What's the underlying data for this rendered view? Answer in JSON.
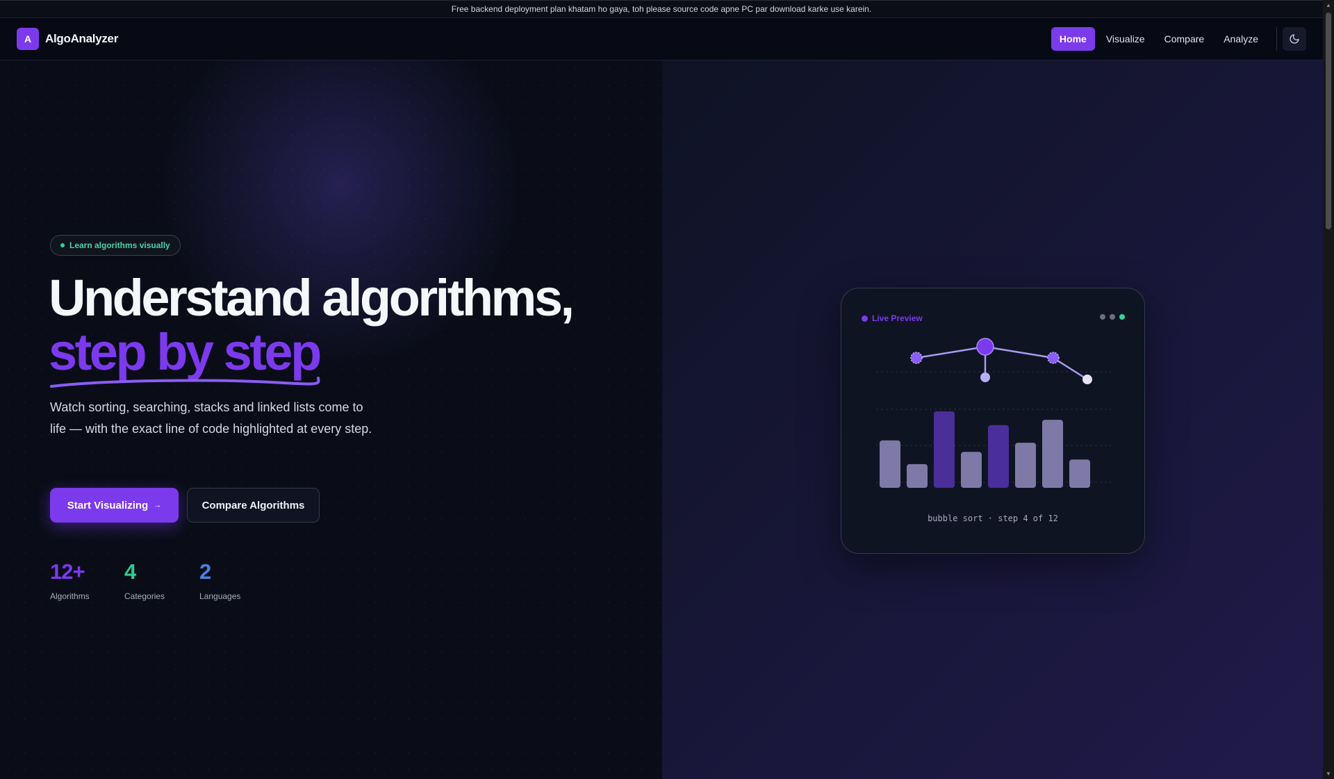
{
  "banner": {
    "text": "Free backend deployment plan khatam ho gaya, toh please source code apne PC par download karke use karein."
  },
  "brand": {
    "logo_letter": "A",
    "name": "AlgoAnalyzer"
  },
  "nav": {
    "links": [
      {
        "label": "Home",
        "active": true
      },
      {
        "label": "Visualize",
        "active": false
      },
      {
        "label": "Compare",
        "active": false
      },
      {
        "label": "Analyze",
        "active": false
      }
    ],
    "theme_toggle_icon": "moon-icon"
  },
  "hero": {
    "badge": "Learn algorithms visually",
    "title_line1": "Understand algorithms,",
    "title_line2": "step by step",
    "description": "Watch sorting, searching, stacks and linked lists come to life — with the exact line of code highlighted at every step.",
    "primary_button": "Start Visualizing",
    "primary_arrow": "→",
    "secondary_button": "Compare Algorithms",
    "stats": [
      {
        "value": "12+",
        "label": "Algorithms",
        "color": "#7c3aed"
      },
      {
        "value": "4",
        "label": "Categories",
        "color": "#34c98f"
      },
      {
        "value": "2",
        "label": "Languages",
        "color": "#4d7fe0"
      }
    ]
  },
  "preview": {
    "title": "Live Preview",
    "caption": "bubble sort · step 4 of 12",
    "bar_values": [
      0.62,
      0.31,
      1.0,
      0.47,
      0.82,
      0.59,
      0.89,
      0.37
    ],
    "bar_highlight": [
      false,
      false,
      true,
      false,
      true,
      false,
      false,
      false
    ],
    "colors": {
      "accent": "#7c3aed",
      "bar": "#7f79a8",
      "bar_active": "#4a2f9a",
      "dot_teal": "#34d399",
      "dot_gray": "#6b6f80"
    }
  }
}
